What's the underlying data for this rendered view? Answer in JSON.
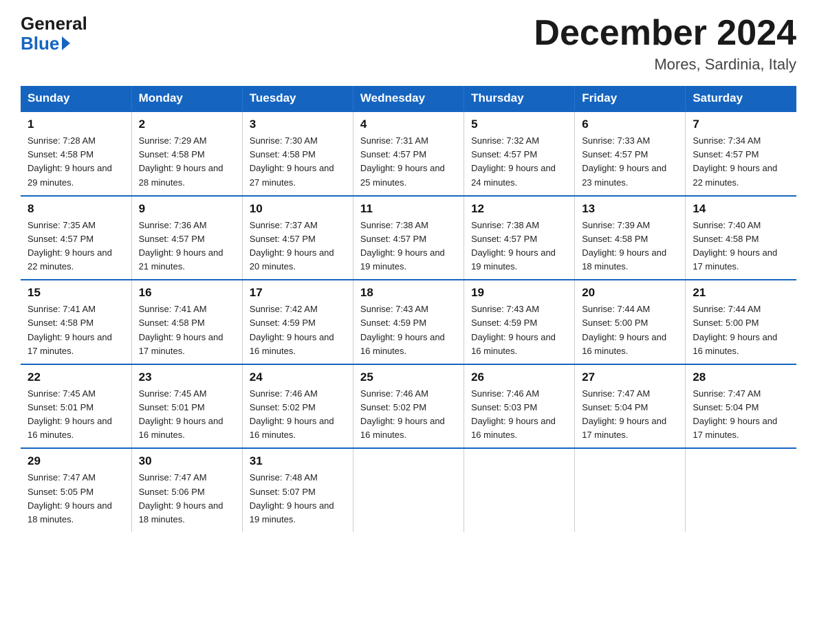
{
  "logo": {
    "general": "General",
    "blue": "Blue"
  },
  "title": "December 2024",
  "subtitle": "Mores, Sardinia, Italy",
  "days_of_week": [
    "Sunday",
    "Monday",
    "Tuesday",
    "Wednesday",
    "Thursday",
    "Friday",
    "Saturday"
  ],
  "weeks": [
    [
      {
        "day": "1",
        "sunrise": "7:28 AM",
        "sunset": "4:58 PM",
        "daylight": "9 hours and 29 minutes."
      },
      {
        "day": "2",
        "sunrise": "7:29 AM",
        "sunset": "4:58 PM",
        "daylight": "9 hours and 28 minutes."
      },
      {
        "day": "3",
        "sunrise": "7:30 AM",
        "sunset": "4:58 PM",
        "daylight": "9 hours and 27 minutes."
      },
      {
        "day": "4",
        "sunrise": "7:31 AM",
        "sunset": "4:57 PM",
        "daylight": "9 hours and 25 minutes."
      },
      {
        "day": "5",
        "sunrise": "7:32 AM",
        "sunset": "4:57 PM",
        "daylight": "9 hours and 24 minutes."
      },
      {
        "day": "6",
        "sunrise": "7:33 AM",
        "sunset": "4:57 PM",
        "daylight": "9 hours and 23 minutes."
      },
      {
        "day": "7",
        "sunrise": "7:34 AM",
        "sunset": "4:57 PM",
        "daylight": "9 hours and 22 minutes."
      }
    ],
    [
      {
        "day": "8",
        "sunrise": "7:35 AM",
        "sunset": "4:57 PM",
        "daylight": "9 hours and 22 minutes."
      },
      {
        "day": "9",
        "sunrise": "7:36 AM",
        "sunset": "4:57 PM",
        "daylight": "9 hours and 21 minutes."
      },
      {
        "day": "10",
        "sunrise": "7:37 AM",
        "sunset": "4:57 PM",
        "daylight": "9 hours and 20 minutes."
      },
      {
        "day": "11",
        "sunrise": "7:38 AM",
        "sunset": "4:57 PM",
        "daylight": "9 hours and 19 minutes."
      },
      {
        "day": "12",
        "sunrise": "7:38 AM",
        "sunset": "4:57 PM",
        "daylight": "9 hours and 19 minutes."
      },
      {
        "day": "13",
        "sunrise": "7:39 AM",
        "sunset": "4:58 PM",
        "daylight": "9 hours and 18 minutes."
      },
      {
        "day": "14",
        "sunrise": "7:40 AM",
        "sunset": "4:58 PM",
        "daylight": "9 hours and 17 minutes."
      }
    ],
    [
      {
        "day": "15",
        "sunrise": "7:41 AM",
        "sunset": "4:58 PM",
        "daylight": "9 hours and 17 minutes."
      },
      {
        "day": "16",
        "sunrise": "7:41 AM",
        "sunset": "4:58 PM",
        "daylight": "9 hours and 17 minutes."
      },
      {
        "day": "17",
        "sunrise": "7:42 AM",
        "sunset": "4:59 PM",
        "daylight": "9 hours and 16 minutes."
      },
      {
        "day": "18",
        "sunrise": "7:43 AM",
        "sunset": "4:59 PM",
        "daylight": "9 hours and 16 minutes."
      },
      {
        "day": "19",
        "sunrise": "7:43 AM",
        "sunset": "4:59 PM",
        "daylight": "9 hours and 16 minutes."
      },
      {
        "day": "20",
        "sunrise": "7:44 AM",
        "sunset": "5:00 PM",
        "daylight": "9 hours and 16 minutes."
      },
      {
        "day": "21",
        "sunrise": "7:44 AM",
        "sunset": "5:00 PM",
        "daylight": "9 hours and 16 minutes."
      }
    ],
    [
      {
        "day": "22",
        "sunrise": "7:45 AM",
        "sunset": "5:01 PM",
        "daylight": "9 hours and 16 minutes."
      },
      {
        "day": "23",
        "sunrise": "7:45 AM",
        "sunset": "5:01 PM",
        "daylight": "9 hours and 16 minutes."
      },
      {
        "day": "24",
        "sunrise": "7:46 AM",
        "sunset": "5:02 PM",
        "daylight": "9 hours and 16 minutes."
      },
      {
        "day": "25",
        "sunrise": "7:46 AM",
        "sunset": "5:02 PM",
        "daylight": "9 hours and 16 minutes."
      },
      {
        "day": "26",
        "sunrise": "7:46 AM",
        "sunset": "5:03 PM",
        "daylight": "9 hours and 16 minutes."
      },
      {
        "day": "27",
        "sunrise": "7:47 AM",
        "sunset": "5:04 PM",
        "daylight": "9 hours and 17 minutes."
      },
      {
        "day": "28",
        "sunrise": "7:47 AM",
        "sunset": "5:04 PM",
        "daylight": "9 hours and 17 minutes."
      }
    ],
    [
      {
        "day": "29",
        "sunrise": "7:47 AM",
        "sunset": "5:05 PM",
        "daylight": "9 hours and 18 minutes."
      },
      {
        "day": "30",
        "sunrise": "7:47 AM",
        "sunset": "5:06 PM",
        "daylight": "9 hours and 18 minutes."
      },
      {
        "day": "31",
        "sunrise": "7:48 AM",
        "sunset": "5:07 PM",
        "daylight": "9 hours and 19 minutes."
      },
      null,
      null,
      null,
      null
    ]
  ]
}
